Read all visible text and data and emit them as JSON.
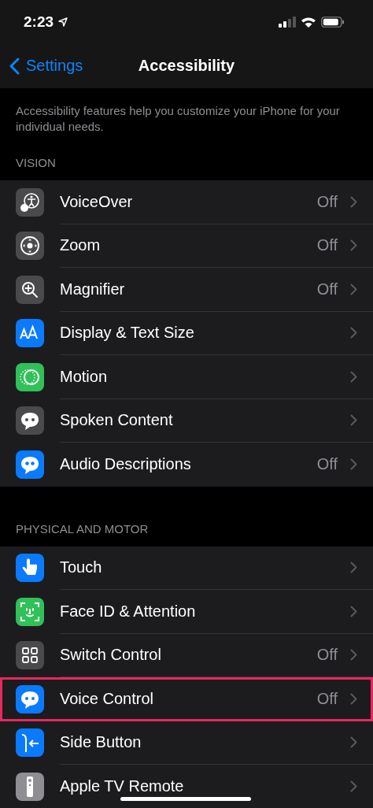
{
  "status_bar": {
    "time": "2:23"
  },
  "nav": {
    "back": "Settings",
    "title": "Accessibility"
  },
  "description": "Accessibility features help you customize your iPhone for your individual needs.",
  "sections": [
    {
      "header": "VISION",
      "rows": [
        {
          "label": "VoiceOver",
          "value": "Off",
          "color": "#4a4a4c",
          "highlighted": false
        },
        {
          "label": "Zoom",
          "value": "Off",
          "color": "#4a4a4c",
          "highlighted": false
        },
        {
          "label": "Magnifier",
          "value": "Off",
          "color": "#4a4a4c",
          "highlighted": false
        },
        {
          "label": "Display & Text Size",
          "color": "#0a7aff",
          "highlighted": false
        },
        {
          "label": "Motion",
          "color": "#30c158",
          "highlighted": false
        },
        {
          "label": "Spoken Content",
          "color": "#4a4a4c",
          "highlighted": false
        },
        {
          "label": "Audio Descriptions",
          "value": "Off",
          "color": "#0a7aff",
          "highlighted": false
        }
      ]
    },
    {
      "header": "PHYSICAL AND MOTOR",
      "rows": [
        {
          "label": "Touch",
          "color": "#0a7aff",
          "highlighted": false
        },
        {
          "label": "Face ID & Attention",
          "color": "#30c158",
          "highlighted": false
        },
        {
          "label": "Switch Control",
          "value": "Off",
          "color": "#4a4a4c",
          "highlighted": false
        },
        {
          "label": "Voice Control",
          "value": "Off",
          "color": "#0a7aff",
          "highlighted": true
        },
        {
          "label": "Side Button",
          "color": "#0a7aff",
          "highlighted": false
        },
        {
          "label": "Apple TV Remote",
          "color": "#8e8e93",
          "highlighted": false
        }
      ]
    }
  ]
}
